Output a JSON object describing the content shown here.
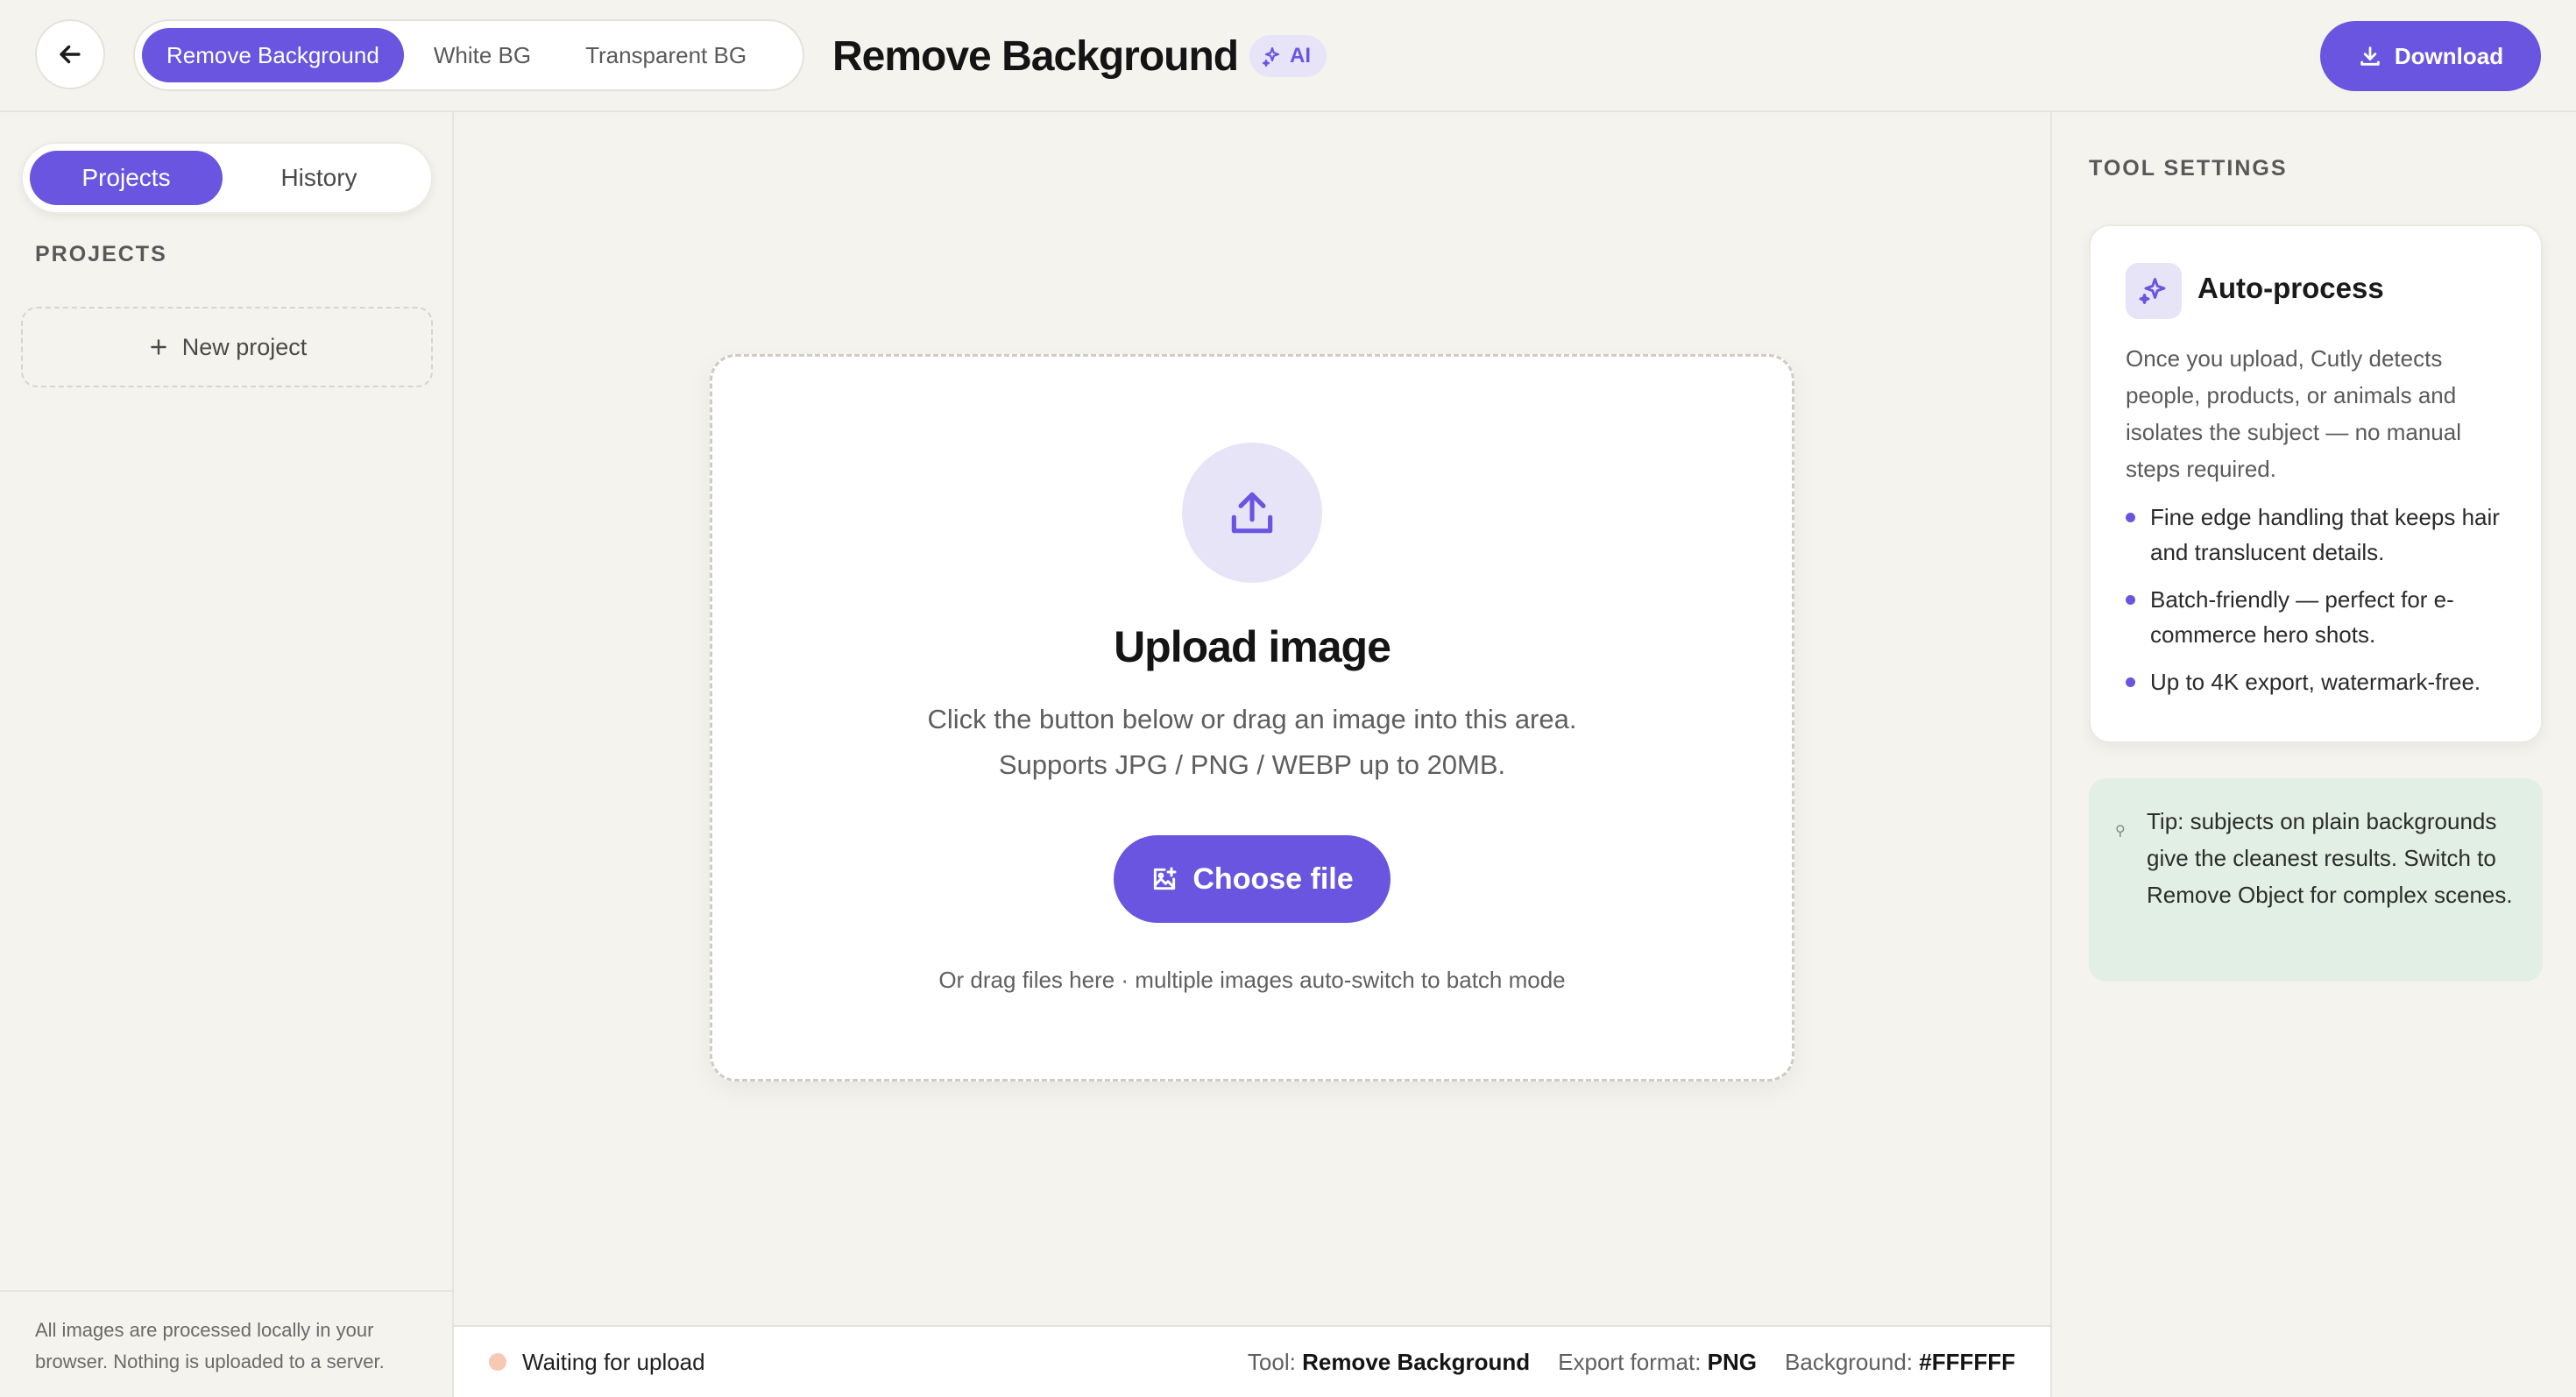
{
  "header": {
    "modes": [
      "Remove Background",
      "White BG",
      "Transparent BG"
    ],
    "title": "Remove Background",
    "badge": "AI",
    "download_label": "Download"
  },
  "sidebar": {
    "tabs": [
      "Projects",
      "History"
    ],
    "section_label": "PROJECTS",
    "new_project_label": "New project",
    "footer_note": "All images are processed locally in your browser. Nothing is uploaded to a server."
  },
  "upload": {
    "title": "Upload image",
    "description": "Click the button below or drag an image into this area. Supports JPG / PNG / WEBP up to 20MB.",
    "button_label": "Choose file",
    "drag_hint": "Or drag files here · multiple images auto-switch to batch mode"
  },
  "status": {
    "text": "Waiting for upload",
    "tool_label": "Tool:",
    "tool_value": "Remove Background",
    "format_label": "Export format:",
    "format_value": "PNG",
    "bg_label": "Background:",
    "bg_value": "#FFFFFF"
  },
  "settings": {
    "section_label": "TOOL SETTINGS",
    "card_title": "Auto-process",
    "card_desc": "Once you upload, Cutly detects people, products, or animals and isolates the subject — no manual steps required.",
    "bullets": [
      "Fine edge handling that keeps hair and translucent details.",
      "Batch-friendly — perfect for e-commerce hero shots.",
      "Up to 4K export, watermark-free."
    ],
    "tip": "Tip: subjects on plain backgrounds give the cleanest results. Switch to Remove Object for complex scenes."
  },
  "colors": {
    "accent": "#6a55e0",
    "accent_soft": "#e8e4f7",
    "tip_bg": "#e1efe4",
    "background": "#f4f3ee"
  },
  "icons": [
    "back-arrow-icon",
    "sparkle-icon",
    "download-icon",
    "plus-icon",
    "upload-icon",
    "image-add-icon",
    "lightbulb-icon"
  ]
}
